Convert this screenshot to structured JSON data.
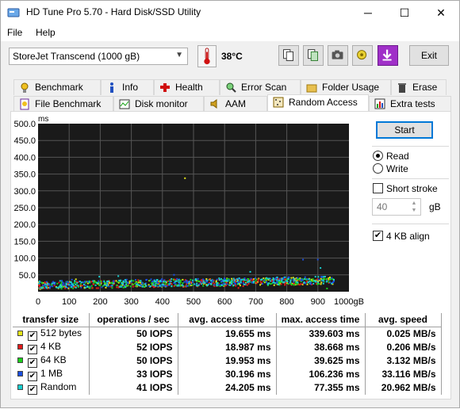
{
  "window": {
    "title": "HD Tune Pro 5.70 - Hard Disk/SSD Utility",
    "minimize": "─",
    "maximize": "☐",
    "close": "✕"
  },
  "menu": {
    "file": "File",
    "help": "Help"
  },
  "toolbar": {
    "drive": "StoreJet Transcend (1000 gB)",
    "temperature": "38°C",
    "exit": "Exit"
  },
  "tabs_top": [
    {
      "label": "Benchmark",
      "icon": "benchmark-icon"
    },
    {
      "label": "Info",
      "icon": "info-icon"
    },
    {
      "label": "Health",
      "icon": "health-icon"
    },
    {
      "label": "Error Scan",
      "icon": "error-scan-icon"
    },
    {
      "label": "Folder Usage",
      "icon": "folder-icon"
    },
    {
      "label": "Erase",
      "icon": "erase-icon"
    }
  ],
  "tabs_bottom": [
    {
      "label": "File Benchmark",
      "icon": "file-benchmark-icon"
    },
    {
      "label": "Disk monitor",
      "icon": "disk-monitor-icon"
    },
    {
      "label": "AAM",
      "icon": "speaker-icon"
    },
    {
      "label": "Random Access",
      "icon": "random-access-icon"
    },
    {
      "label": "Extra tests",
      "icon": "extra-tests-icon"
    }
  ],
  "side": {
    "start": "Start",
    "read": "Read",
    "write": "Write",
    "short_stroke": "Short stroke",
    "stroke_value": "40",
    "stroke_unit": "gB",
    "align": "4 KB align",
    "read_selected": true,
    "short_stroke_checked": false,
    "align_checked": true
  },
  "chart_data": {
    "type": "scatter",
    "ylabel": "ms",
    "xlabel": "gB",
    "ylim": [
      0,
      500
    ],
    "xlim": [
      0,
      1000
    ],
    "y_ticks": [
      "500.0",
      "450.0",
      "400.0",
      "350.0",
      "300.0",
      "250.0",
      "200.0",
      "150.0",
      "100.0",
      "50.0"
    ],
    "x_ticks": [
      "0",
      "100",
      "200",
      "300",
      "400",
      "500",
      "600",
      "700",
      "800",
      "900",
      "1000gB"
    ],
    "background": "#1a1a1a",
    "grid": true,
    "series": [
      {
        "color": "#e5e51a",
        "y_min": 10,
        "y_max": 45,
        "outliers": [
          340
        ]
      },
      {
        "color": "#e01b1b",
        "y_min": 10,
        "y_max": 39
      },
      {
        "color": "#1bd11b",
        "y_min": 10,
        "y_max": 40
      },
      {
        "color": "#1b4fe0",
        "y_min": 12,
        "y_max": 106
      },
      {
        "color": "#18d0d0",
        "y_min": 12,
        "y_max": 77
      }
    ]
  },
  "results": {
    "headers": [
      "transfer size",
      "operations / sec",
      "avg. access time",
      "max. access time",
      "avg. speed"
    ],
    "rows": [
      {
        "color": "#e5e51a",
        "size": "512 bytes",
        "ops": "50 IOPS",
        "avg": "19.655 ms",
        "max": "339.603 ms",
        "speed": "0.025 MB/s"
      },
      {
        "color": "#e01b1b",
        "size": "4 KB",
        "ops": "52 IOPS",
        "avg": "18.987 ms",
        "max": "38.668 ms",
        "speed": "0.206 MB/s"
      },
      {
        "color": "#1bd11b",
        "size": "64 KB",
        "ops": "50 IOPS",
        "avg": "19.953 ms",
        "max": "39.625 ms",
        "speed": "3.132 MB/s"
      },
      {
        "color": "#1b4fe0",
        "size": "1 MB",
        "ops": "33 IOPS",
        "avg": "30.196 ms",
        "max": "106.236 ms",
        "speed": "33.116 MB/s"
      },
      {
        "color": "#18d0d0",
        "size": "Random",
        "ops": "41 IOPS",
        "avg": "24.205 ms",
        "max": "77.355 ms",
        "speed": "20.962 MB/s"
      }
    ]
  }
}
